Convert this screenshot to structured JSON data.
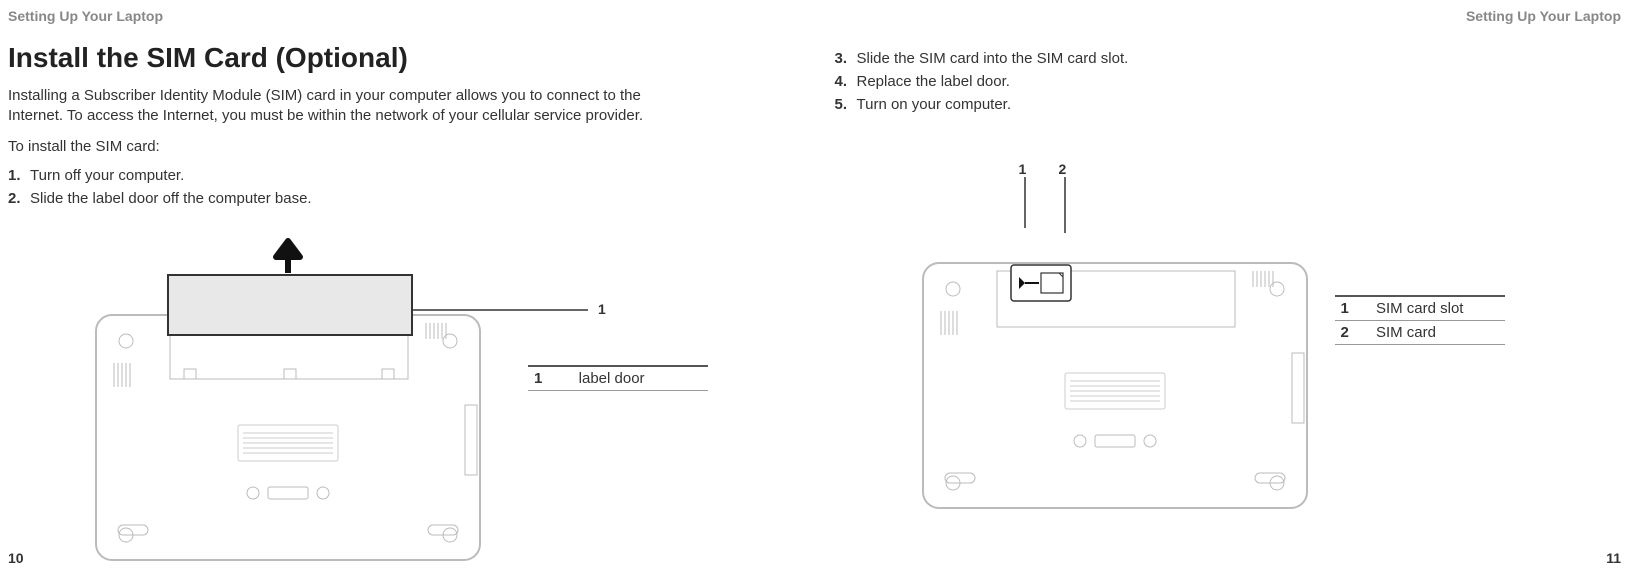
{
  "left": {
    "header": "Setting Up Your Laptop",
    "title": "Install the SIM Card (Optional)",
    "intro": "Installing a Subscriber Identity Module (SIM) card in your computer allows you to connect to the Internet. To access the Internet, you must be within the network of your cellular service provider.",
    "lead": "To install the SIM card:",
    "steps": [
      {
        "n": "1.",
        "t": "Turn off your computer."
      },
      {
        "n": "2.",
        "t": "Slide the label door off the computer base."
      }
    ],
    "callout1": "1",
    "legend": [
      {
        "n": "1",
        "l": "label door"
      }
    ],
    "pageNum": "10"
  },
  "right": {
    "header": "Setting Up Your Laptop",
    "steps": [
      {
        "n": "3.",
        "t": "Slide the SIM card into the SIM card slot."
      },
      {
        "n": "4.",
        "t": "Replace the label door."
      },
      {
        "n": "5.",
        "t": "Turn on your computer."
      }
    ],
    "callout1": "1",
    "callout2": "2",
    "legend": [
      {
        "n": "1",
        "l": "SIM card slot"
      },
      {
        "n": "2",
        "l": "SIM card"
      }
    ],
    "pageNum": "11"
  }
}
